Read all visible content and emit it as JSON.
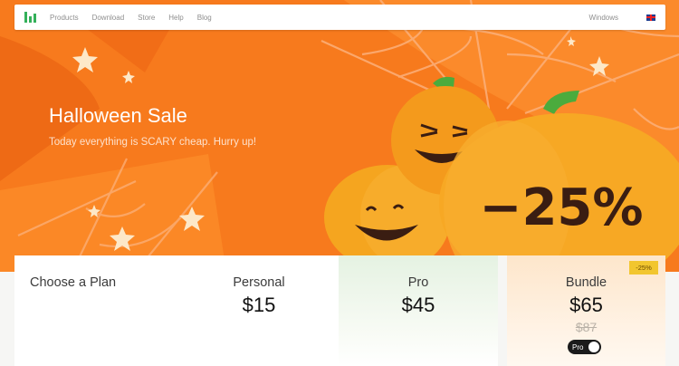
{
  "nav": {
    "items": [
      "Products",
      "Download",
      "Store",
      "Help",
      "Blog"
    ],
    "os": "Windows",
    "language_icon": "uk-flag-icon",
    "logo_icon": "bars-logo-icon"
  },
  "hero": {
    "title": "Halloween Sale",
    "subtitle": "Today everything is SCARY cheap. Hurry up!",
    "discount": "−25%"
  },
  "plans": {
    "heading": "Choose a Plan",
    "personal": {
      "name": "Personal",
      "price": "$15"
    },
    "pro": {
      "name": "Pro",
      "price": "$45"
    },
    "bundle": {
      "name": "Bundle",
      "price": "$65",
      "old_price": "$87",
      "badge": "-25%",
      "toggle_label": "Pro"
    }
  },
  "colors": {
    "hero": "#f77a1d",
    "pumpkin": "#f5a51f",
    "logo": "#34b05a",
    "badge": "#f2c62f"
  }
}
